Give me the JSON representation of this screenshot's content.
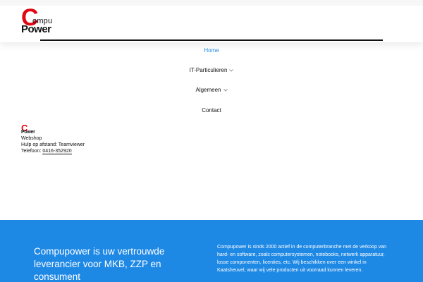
{
  "logo": {
    "initial": "C",
    "compu": "ompu",
    "power": "Power"
  },
  "nav": {
    "items": [
      {
        "label": "Home",
        "active": true,
        "has_dropdown": false
      },
      {
        "label": "IT-Particulieren",
        "active": false,
        "has_dropdown": true
      },
      {
        "label": "Algemeen",
        "active": false,
        "has_dropdown": true
      },
      {
        "label": "Contact",
        "active": false,
        "has_dropdown": false
      }
    ],
    "chevron_icon": "chevron-down-icon"
  },
  "footer_info": {
    "mini_logo": {
      "initial": "C",
      "power": "Power"
    },
    "webshop": "Webshop",
    "remote_help": "Hulp op afstand: Teamviewer",
    "phone_label": "Telefoon: ",
    "phone_number": "0416-352920"
  },
  "promo": {
    "title": "Compupower is uw vertrouwde leverancier voor MKB, ZZP en consument",
    "text": "Compupower is sinds 2000 actief in de computerbranche met de verkoop van hard- en software, zoals computersystemen, notebooks, netwerk apparatuur, losse componenten, licenties, etc. Wij beschikken over een winkel in Kaatsheuvel, waar wij vele producten uit voorraad kunnen leveren."
  },
  "colors": {
    "accent": "#1e88e5",
    "brand_red": "#e30613",
    "text": "#111111"
  }
}
